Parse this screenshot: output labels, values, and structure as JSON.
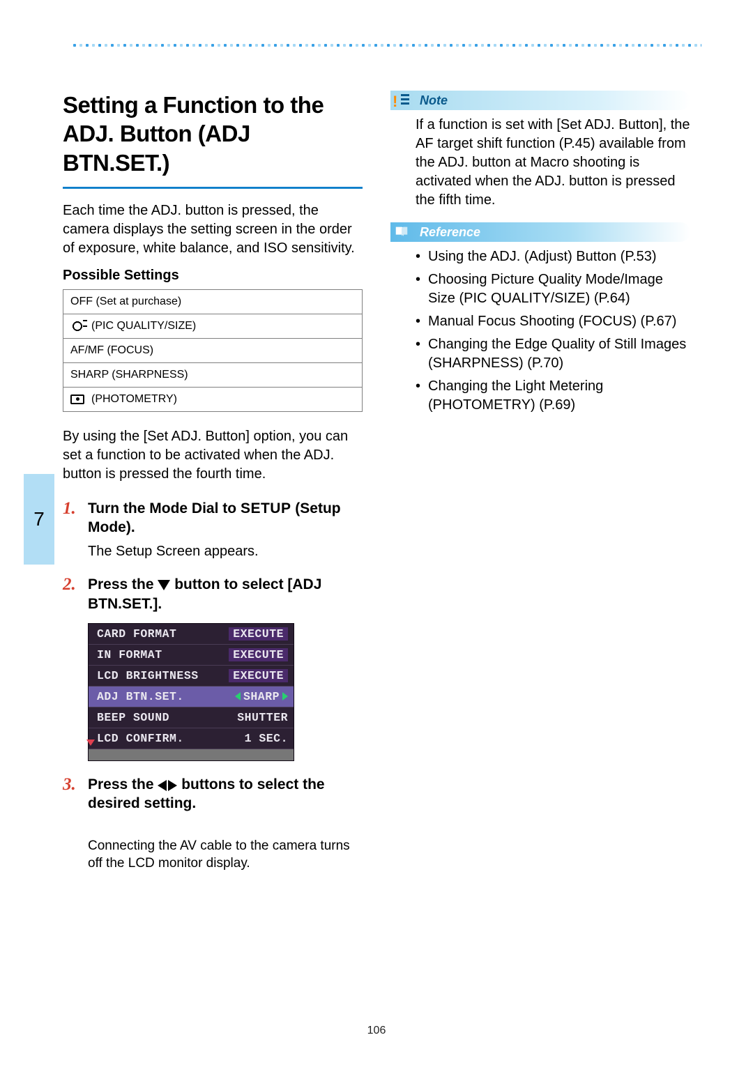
{
  "page_number": "106",
  "chapter_tab": "7",
  "left": {
    "title": "Setting a Function to the ADJ. Button (ADJ BTN.SET.)",
    "intro": "Each time the ADJ. button is pressed, the camera displays the setting screen in the order of exposure, white balance, and ISO sensitivity.",
    "possible_settings_label": "Possible Settings",
    "settings_rows": [
      {
        "text": "OFF (Set at purchase)"
      },
      {
        "icon": "quality",
        "text": "(PIC QUALITY/SIZE)"
      },
      {
        "text": "AF/MF (FOCUS)"
      },
      {
        "text": "SHARP (SHARPNESS)"
      },
      {
        "icon": "photometry",
        "text": "(PHOTOMETRY)"
      }
    ],
    "after_table": "By using the [Set ADJ. Button] option, you can set a function to be activated when the ADJ. button is pressed the fourth time.",
    "steps": [
      {
        "num": "1.",
        "title_pre": "Turn the Mode Dial to ",
        "title_setuptoken": "SETUP",
        "title_post": " (Setup Mode).",
        "body": "The Setup Screen appears."
      },
      {
        "num": "2.",
        "title_pre": "Press the ",
        "title_icon": "down",
        "title_post": " button to select [ADJ BTN.SET.].",
        "lcd": {
          "rows": [
            {
              "label": "CARD FORMAT",
              "value": "EXECUTE",
              "exec": true
            },
            {
              "label": "IN FORMAT",
              "value": "EXECUTE",
              "exec": true
            },
            {
              "label": "LCD BRIGHTNESS",
              "value": "EXECUTE",
              "exec": true
            },
            {
              "label": "ADJ BTN.SET.",
              "value": "SHARP",
              "selected": true,
              "lr": true
            },
            {
              "label": "BEEP SOUND",
              "value": "SHUTTER"
            },
            {
              "label": "LCD CONFIRM.",
              "value": "1 SEC."
            }
          ]
        }
      },
      {
        "num": "3.",
        "title_pre": "Press the ",
        "title_icon": "lr",
        "title_post": " buttons to select the desired setting."
      }
    ],
    "footnote": "Connecting the AV cable to the camera turns off the LCD monitor display."
  },
  "right": {
    "note_label": "Note",
    "note_body": "If a function is set with [Set ADJ. Button], the AF target shift function (P.45) available from the ADJ. button at Macro shooting is activated when the ADJ. button is pressed the fifth time.",
    "reference_label": "Reference",
    "reference_items": [
      "Using the ADJ. (Adjust) Button (P.53)",
      "Choosing Picture Quality Mode/Image Size (PIC QUALITY/SIZE) (P.64)",
      "Manual Focus Shooting (FOCUS) (P.67)",
      "Changing the Edge Quality of Still Images (SHARPNESS) (P.70)",
      "Changing the Light Metering (PHOTOMETRY) (P.69)"
    ]
  }
}
